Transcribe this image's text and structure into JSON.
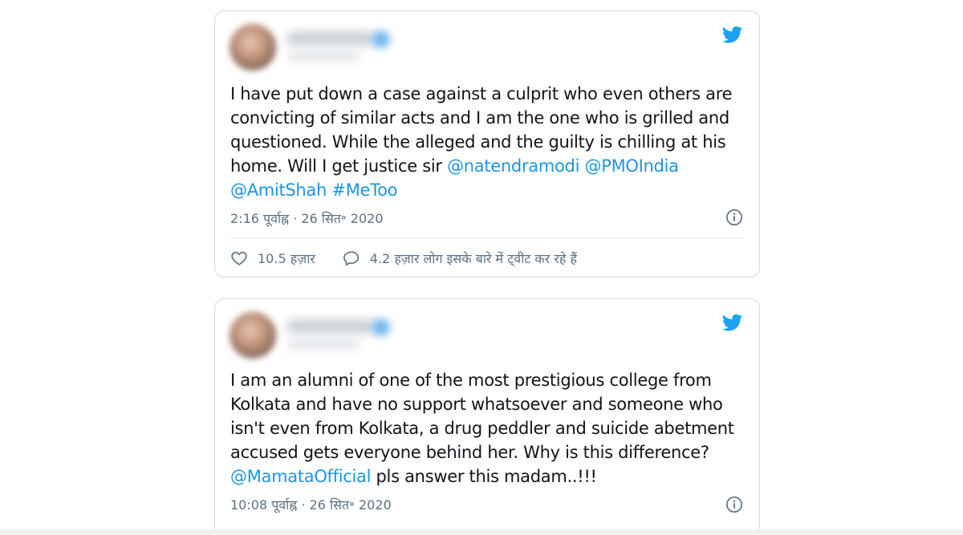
{
  "tweets": [
    {
      "text_parts": [
        {
          "text": "I have put down a case against a culprit who even others are convicting of similar acts and I am the one who is grilled and questioned. While the alleged and the guilty is chilling at his home. Will I get justice sir ",
          "type": "plain"
        },
        {
          "text": "@natendramodi",
          "type": "mention"
        },
        {
          "text": " ",
          "type": "plain"
        },
        {
          "text": "@PMOIndia",
          "type": "mention"
        },
        {
          "text": " ",
          "type": "plain"
        },
        {
          "text": "@AmitShah",
          "type": "mention"
        },
        {
          "text": " ",
          "type": "plain"
        },
        {
          "text": "#MeToo",
          "type": "mention"
        }
      ],
      "timestamp": "2:16 पूर्वाह्न · 26 सित॰ 2020",
      "likes": "10.5 हज़ार",
      "tweeting": "4.2 हज़ार लोग इसके बारे में ट्वीट कर रहे हैं"
    },
    {
      "text_parts": [
        {
          "text": "I am an alumni of one of the most prestigious college from Kolkata and have no support whatsoever and someone who isn't even from Kolkata, a drug peddler and suicide abetment accused gets everyone behind her. Why is this difference? ",
          "type": "plain"
        },
        {
          "text": "@MamataOfficial",
          "type": "mention"
        },
        {
          "text": " pls answer this madam..!!!",
          "type": "plain"
        }
      ],
      "timestamp": "10:08 पूर्वाह्न · 26 सित॰ 2020"
    }
  ],
  "icons": {
    "brand": "twitter-bird-icon",
    "info": "info-icon",
    "like": "heart-icon",
    "reply": "speech-bubble-icon"
  },
  "colors": {
    "brand_blue": "#1da1f2",
    "link_blue": "#1b95e0",
    "text": "#0f1419",
    "secondary_text": "#5b7083",
    "border": "#cfd9de"
  }
}
